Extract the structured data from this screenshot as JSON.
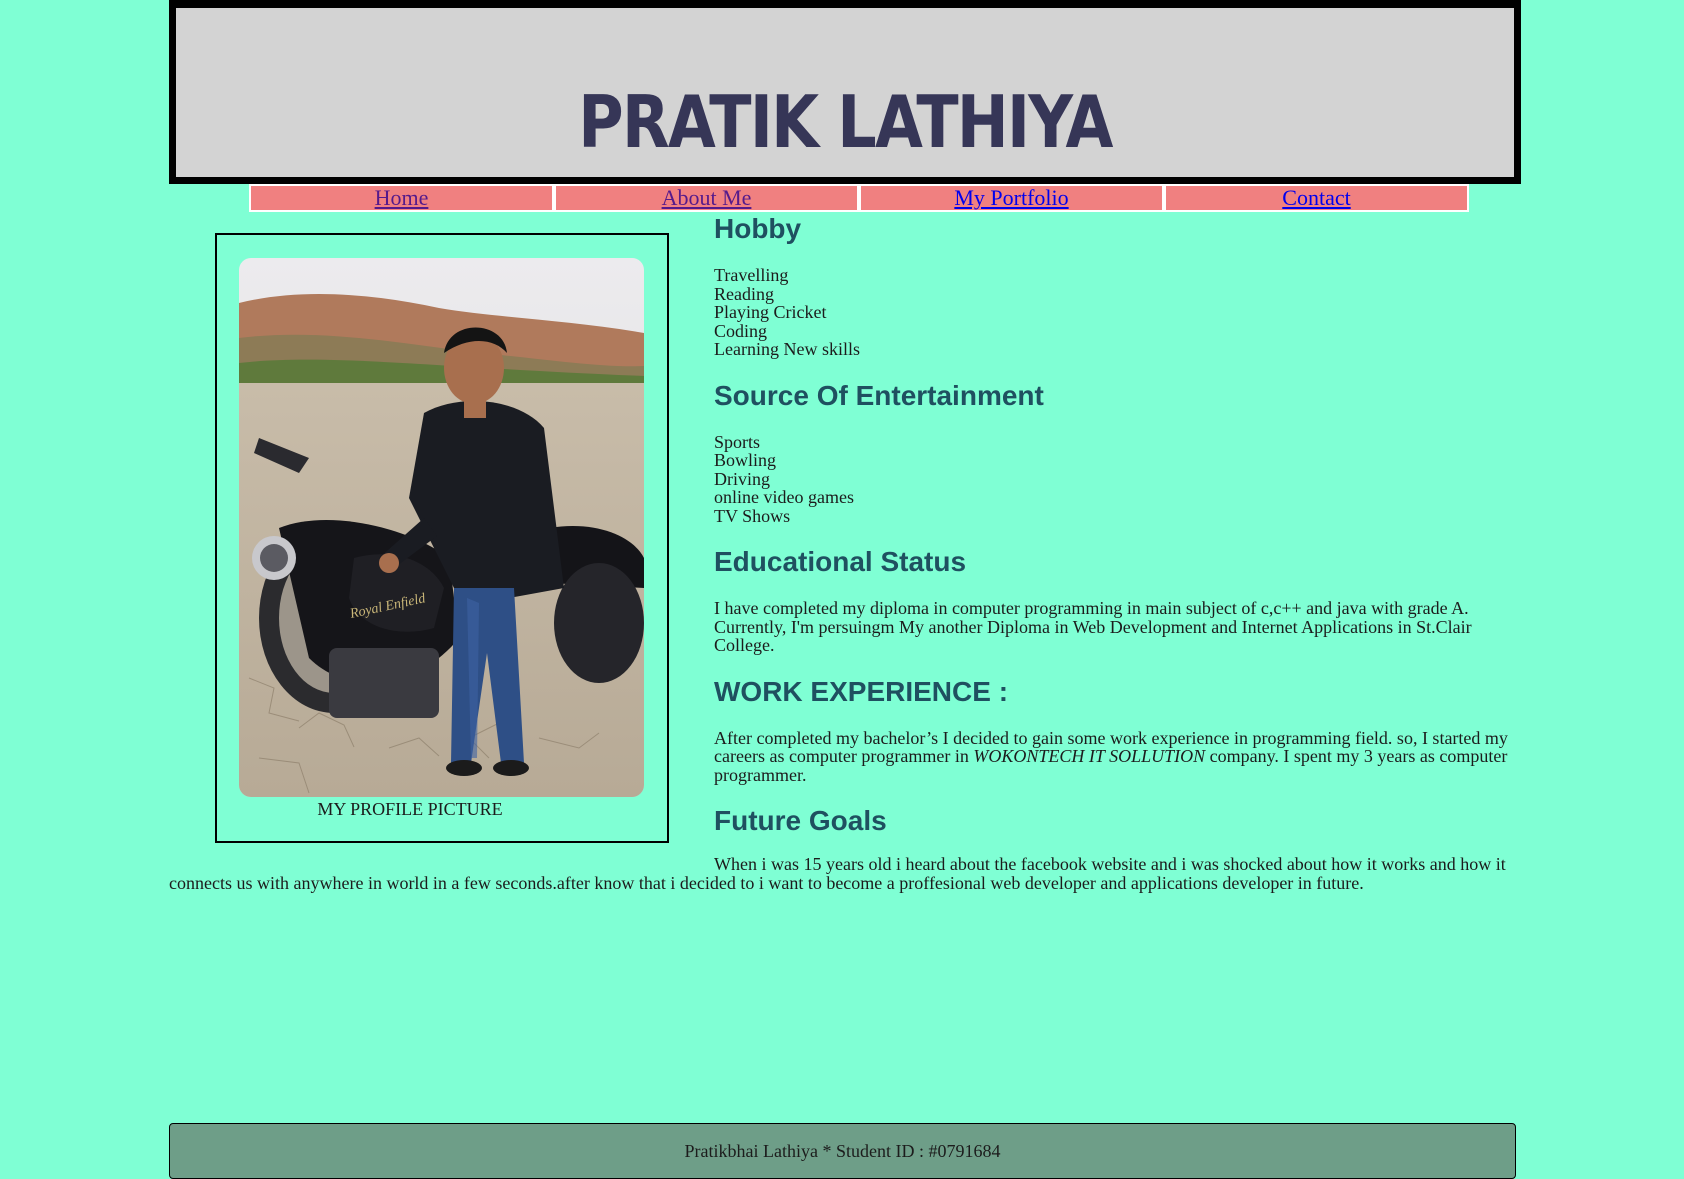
{
  "header": {
    "title": "PRATIK LATHIYA"
  },
  "nav": {
    "items": [
      {
        "label": "Home"
      },
      {
        "label": "About Me"
      },
      {
        "label": "My Portfolio"
      },
      {
        "label": "Contact"
      }
    ]
  },
  "profile": {
    "caption": "MY PROFILE PICTURE"
  },
  "sections": {
    "hobby": {
      "title": "Hobby",
      "items": [
        "Travelling",
        "Reading",
        "Playing Cricket",
        "Coding",
        "Learning New skills"
      ]
    },
    "entertainment": {
      "title": "Source Of Entertainment",
      "items": [
        "Sports",
        "Bowling",
        "Driving",
        "online video games",
        "TV Shows"
      ]
    },
    "education": {
      "title": "Educational Status",
      "text": "I have completed my diploma in computer programming in main subject of c,c++ and java with grade A. Currently, I'm persuingm My another Diploma in Web Development and Internet Applications in St.Clair College."
    },
    "work": {
      "title": "WORK EXPERIENCE :",
      "text_before": "After completed my bachelor’s I decided to gain some work experience in programming field. so, I started my careers as computer programmer in ",
      "company": "WOKONTECH IT SOLLUTION",
      "text_after": " company. I spent my 3 years as computer programmer."
    },
    "future": {
      "title": "Future Goals",
      "text": "When i was 15 years old i heard about the facebook website and i was shocked about how it works and how it connects us with anywhere in world in a few seconds.after know that i decided to i want to become a proffesional web developer and applications developer in future."
    }
  },
  "footer": {
    "text": "Pratikbhai Lathiya * Student ID : #0791684"
  },
  "colors": {
    "page_bg": "#7fffd4",
    "header_bg": "#d3d3d3",
    "title_color": "#363657",
    "nav_bg": "#f08080",
    "heading_color": "#1f5060",
    "footer_bg": "#6e9e88"
  }
}
